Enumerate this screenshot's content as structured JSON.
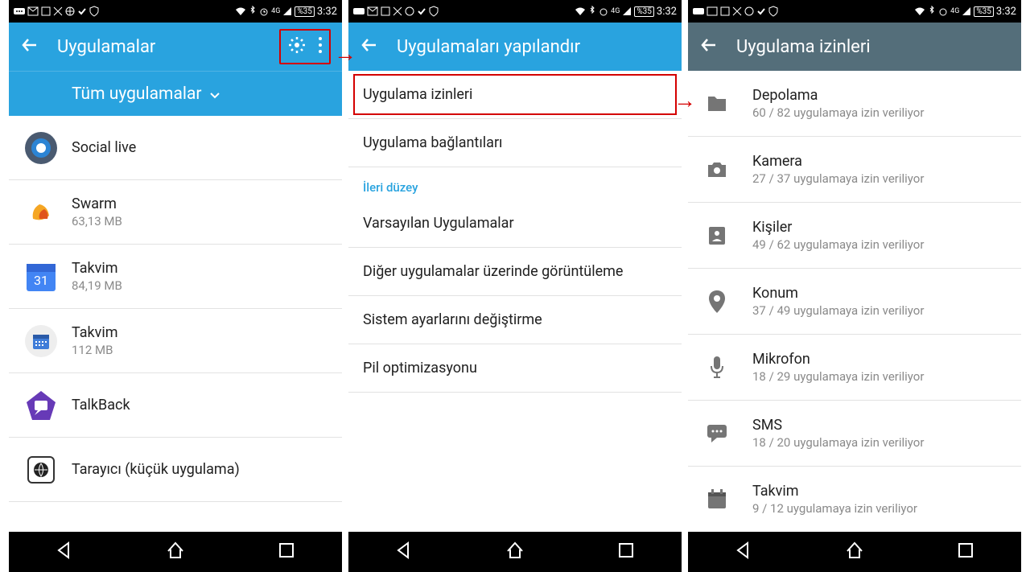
{
  "status": {
    "battery": "%35",
    "time": "3:32",
    "net": "4G"
  },
  "panel1": {
    "title": "Uygulamalar",
    "filter": "Tüm uygulamalar",
    "apps": [
      {
        "name": "Social live",
        "sub": ""
      },
      {
        "name": "Swarm",
        "sub": "63,13 MB"
      },
      {
        "name": "Takvim",
        "sub": "84,19 MB"
      },
      {
        "name": "Takvim",
        "sub": "112 MB"
      },
      {
        "name": "TalkBack",
        "sub": ""
      },
      {
        "name": "Tarayıcı (küçük uygulama)",
        "sub": ""
      }
    ]
  },
  "panel2": {
    "title": "Uygulamaları yapılandır",
    "items": [
      "Uygulama izinleri",
      "Uygulama bağlantıları"
    ],
    "section": "İleri düzey",
    "advanced": [
      "Varsayılan Uygulamalar",
      "Diğer uygulamalar üzerinde görüntüleme",
      "Sistem ayarlarını değiştirme",
      "Pil optimizasyonu"
    ]
  },
  "panel3": {
    "title": "Uygulama izinleri",
    "perms": [
      {
        "name": "Depolama",
        "sub": "60 / 82 uygulamaya izin veriliyor"
      },
      {
        "name": "Kamera",
        "sub": "27 / 37 uygulamaya izin veriliyor"
      },
      {
        "name": "Kişiler",
        "sub": "49 / 62 uygulamaya izin veriliyor"
      },
      {
        "name": "Konum",
        "sub": "37 / 49 uygulamaya izin veriliyor"
      },
      {
        "name": "Mikrofon",
        "sub": "18 / 29 uygulamaya izin veriliyor"
      },
      {
        "name": "SMS",
        "sub": "18 / 20 uygulamaya izin veriliyor"
      },
      {
        "name": "Takvim",
        "sub": "9 / 12 uygulamaya izin veriliyor"
      }
    ]
  }
}
